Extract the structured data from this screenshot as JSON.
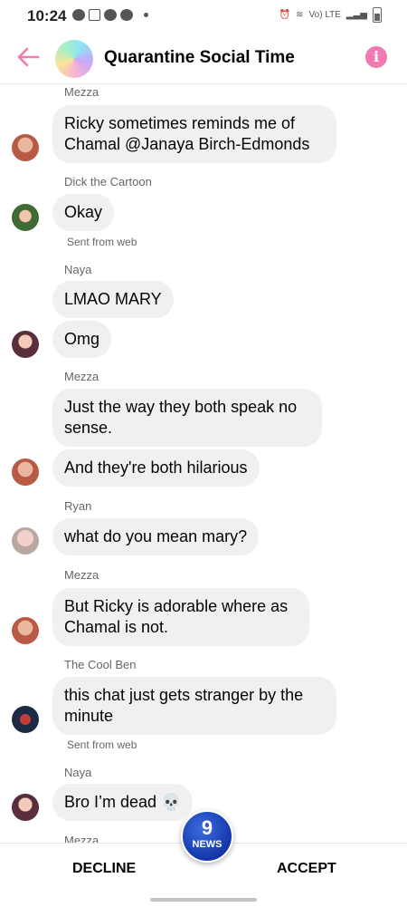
{
  "status": {
    "time": "10:24",
    "network": "Vo) LTE"
  },
  "header": {
    "title": "Quarantine Social Time",
    "info_symbol": "i"
  },
  "messages": [
    {
      "sender": "Mezza",
      "texts": [
        "Ricky sometimes reminds me of Chamal @Janaya Birch-Edmonds"
      ]
    },
    {
      "sender": "Dick the Cartoon",
      "texts": [
        "Okay"
      ],
      "meta": "Sent from web"
    },
    {
      "sender": "Naya",
      "texts": [
        "LMAO MARY",
        "Omg"
      ]
    },
    {
      "sender": "Mezza",
      "texts": [
        "Just the way they both speak no sense.",
        "And they're both hilarious"
      ]
    },
    {
      "sender": "Ryan",
      "texts": [
        "what do you mean mary?"
      ]
    },
    {
      "sender": "Mezza",
      "texts": [
        "But Ricky is adorable where as Chamal is not."
      ]
    },
    {
      "sender": "The Cool Ben",
      "texts": [
        "this chat just gets stranger by the minute"
      ],
      "meta": "Sent from web"
    },
    {
      "sender": "Naya",
      "texts": [
        "Bro I’m dead 💀"
      ]
    },
    {
      "sender": "Mezza"
    }
  ],
  "footer": {
    "decline": "DECLINE",
    "accept": "ACCEPT"
  },
  "news_badge": {
    "number": "9",
    "label": "NEWS"
  },
  "colors": {
    "accent": "#f07ab1",
    "bubble": "#f0f0f0"
  }
}
